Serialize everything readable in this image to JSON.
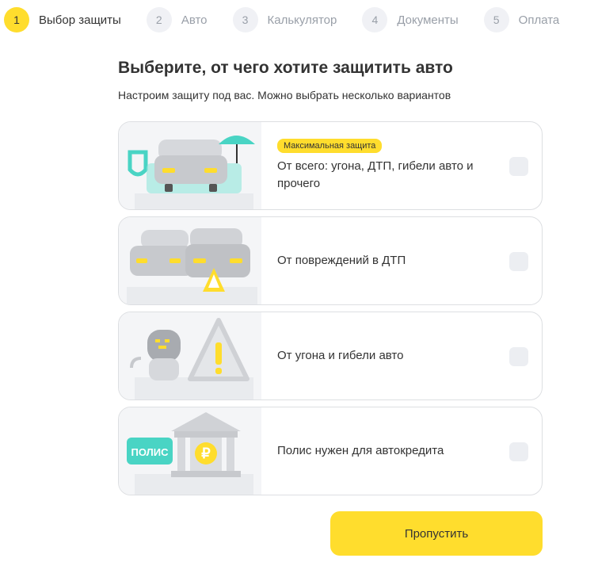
{
  "stepper": {
    "steps": [
      {
        "num": "1",
        "label": "Выбор защиты"
      },
      {
        "num": "2",
        "label": "Авто"
      },
      {
        "num": "3",
        "label": "Калькулятор"
      },
      {
        "num": "4",
        "label": "Документы"
      },
      {
        "num": "5",
        "label": "Оплата"
      }
    ],
    "active": 1
  },
  "page": {
    "title": "Выберите, от чего хотите защитить авто",
    "subtitle": "Настроим защиту под вас. Можно выбрать несколько вариантов"
  },
  "options": [
    {
      "badge": "Максимальная защита",
      "label": "От всего: угона, ДТП, гибели авто и прочего",
      "icon": "car-shield-umbrella-icon",
      "checked": false
    },
    {
      "label": "От повреждений в ДТП",
      "icon": "car-crash-icon",
      "checked": false
    },
    {
      "label": "От угона и гибели авто",
      "icon": "thief-warning-icon",
      "checked": false
    },
    {
      "label": "Полис нужен для автокредита",
      "icon": "bank-policy-icon",
      "image_text": "ПОЛИС",
      "checked": false
    }
  ],
  "actions": {
    "skip_label": "Пропустить"
  },
  "colors": {
    "accent": "#ffdd2d",
    "teal": "#49d4c4",
    "border": "#dddfe2",
    "muted": "#999fa8"
  }
}
